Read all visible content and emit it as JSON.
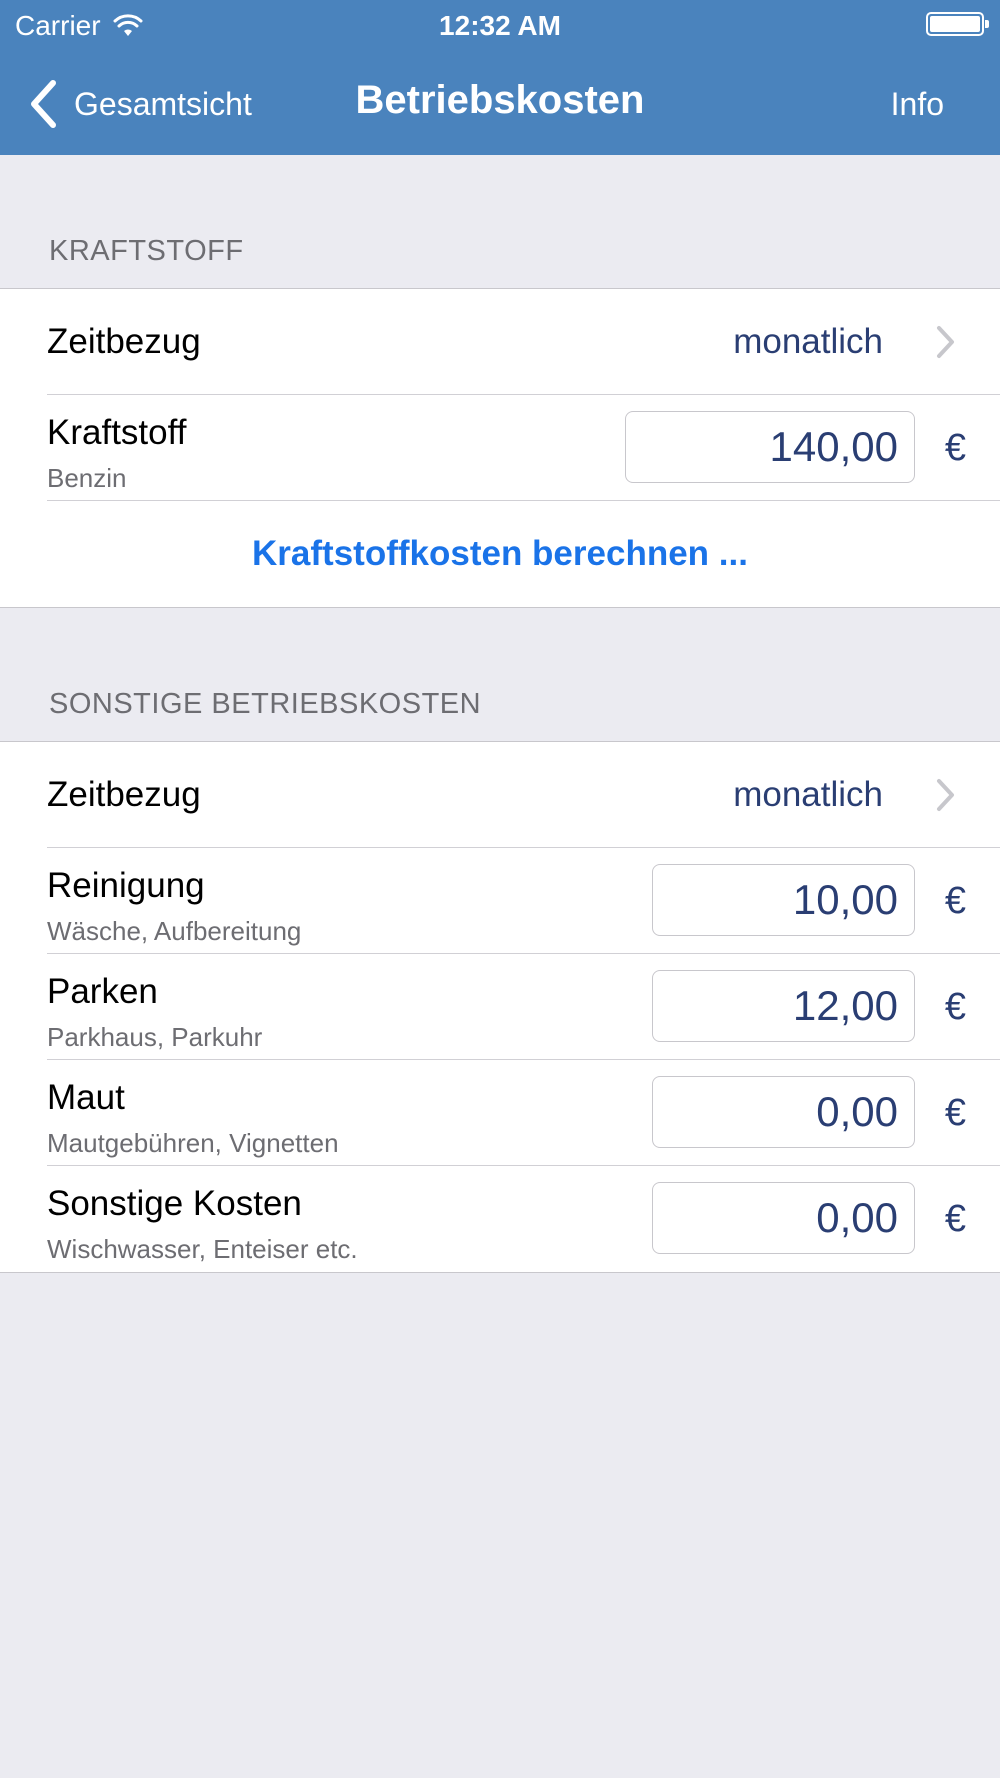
{
  "status": {
    "carrier": "Carrier",
    "time": "12:32 AM"
  },
  "nav": {
    "back_label": "Gesamtsicht",
    "title": "Betriebskosten",
    "info_label": "Info"
  },
  "fuel_section": {
    "header": "KRAFTSTOFF",
    "period_label": "Zeitbezug",
    "period_value": "monatlich",
    "fuel_title": "Kraftstoff",
    "fuel_subtitle": "Benzin",
    "fuel_amount": "140,00",
    "currency": "€",
    "action_label": "Kraftstoffkosten berechnen ..."
  },
  "other_section": {
    "header": "SONSTIGE BETRIEBSKOSTEN",
    "period_label": "Zeitbezug",
    "period_value": "monatlich",
    "items": [
      {
        "title": "Reinigung",
        "subtitle": "Wäsche, Aufbereitung",
        "amount": "10,00",
        "currency": "€"
      },
      {
        "title": "Parken",
        "subtitle": "Parkhaus, Parkuhr",
        "amount": "12,00",
        "currency": "€"
      },
      {
        "title": "Maut",
        "subtitle": "Mautgebühren, Vignetten",
        "amount": "0,00",
        "currency": "€"
      },
      {
        "title": "Sonstige Kosten",
        "subtitle": "Wischwasser, Enteiser etc.",
        "amount": "0,00",
        "currency": "€"
      }
    ]
  },
  "colors": {
    "nav_bar": "#4a83bd",
    "accent_blue": "#1a73e8",
    "value_text": "#2a3e73",
    "background": "#ebebf1"
  }
}
